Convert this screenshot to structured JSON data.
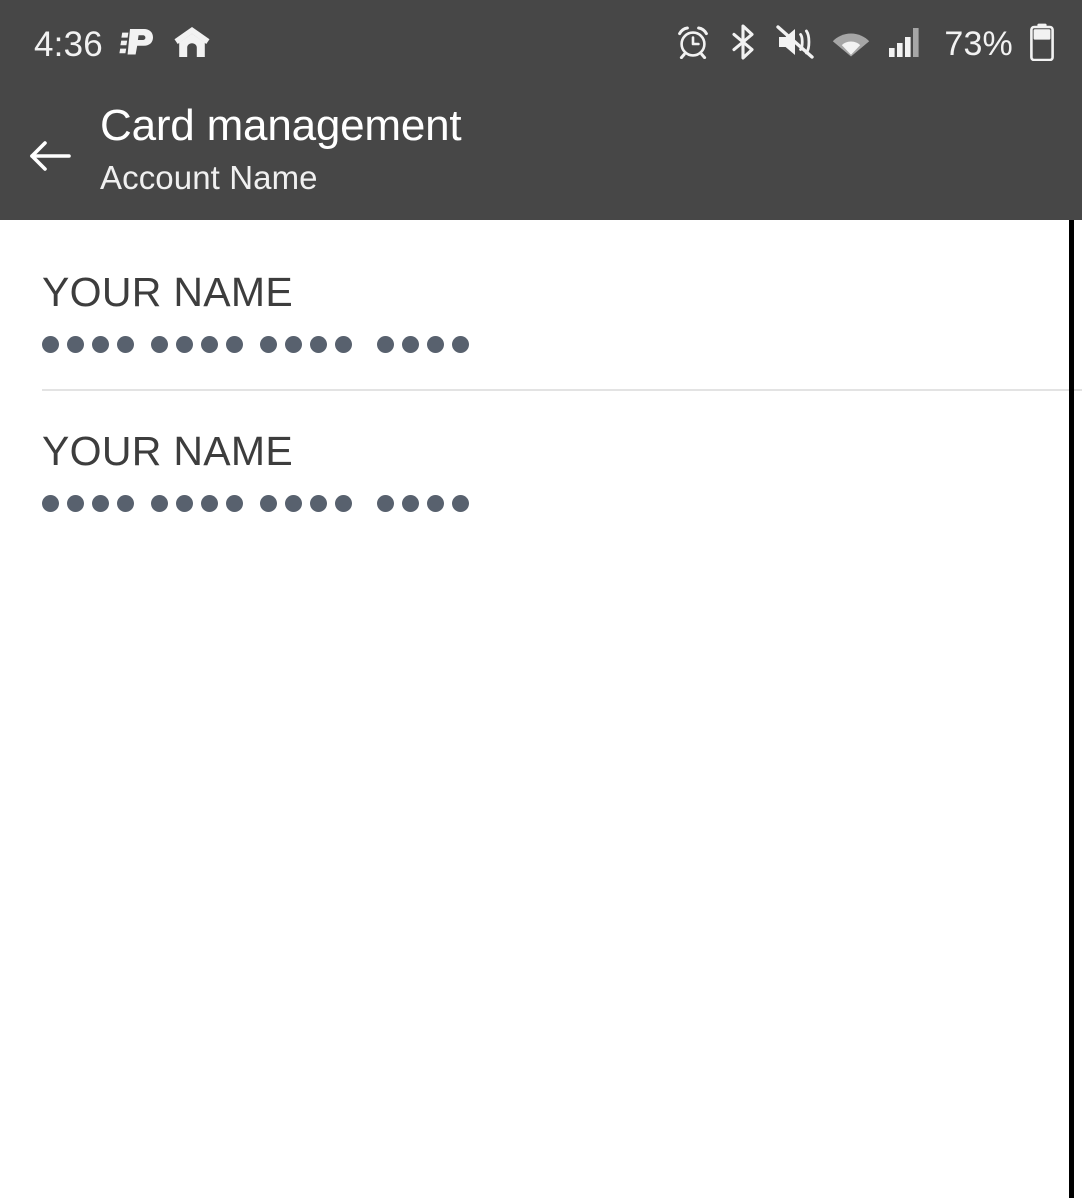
{
  "status_bar": {
    "time": "4:36",
    "battery_percent": "73%",
    "left_icons": [
      {
        "name": "app-logo-p-icon"
      },
      {
        "name": "home-icon"
      }
    ],
    "right_icons": [
      {
        "name": "alarm-clock-icon"
      },
      {
        "name": "bluetooth-icon"
      },
      {
        "name": "volume-mute-vibrate-icon"
      },
      {
        "name": "wifi-icon"
      },
      {
        "name": "cellular-signal-icon"
      },
      {
        "name": "battery-icon"
      }
    ],
    "background_color": "#474747",
    "text_color": "#f2f2f2"
  },
  "app_bar": {
    "back_icon": "arrow-left-icon",
    "title": "Card management",
    "subtitle": "Account Name",
    "background_color": "#474747",
    "title_color": "#ffffff"
  },
  "content": {
    "cards": [
      {
        "holder_name": "YOUR NAME",
        "masked_number_groups": [
          4,
          4,
          4,
          4
        ],
        "dot_color": "#58616e"
      },
      {
        "holder_name": "YOUR NAME",
        "masked_number_groups": [
          4,
          4,
          4,
          4
        ],
        "dot_color": "#58616e"
      }
    ],
    "divider_color": "#e3e3e3",
    "background_color": "#ffffff"
  }
}
